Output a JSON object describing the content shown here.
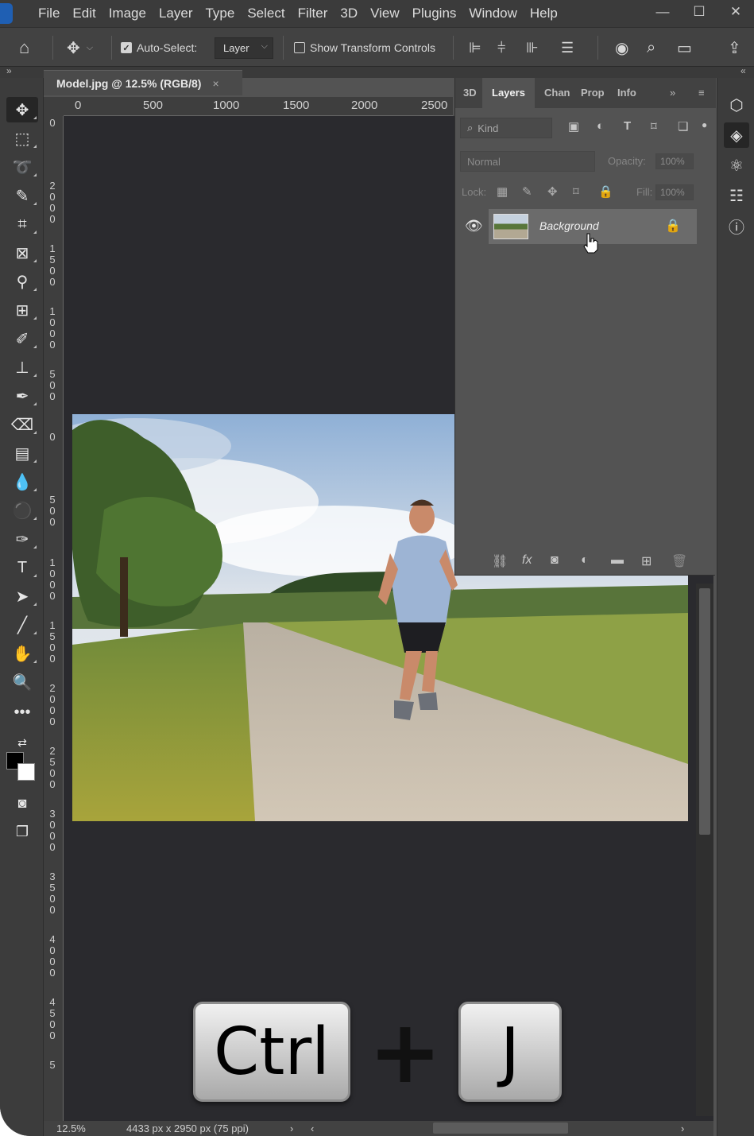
{
  "menu": {
    "items": [
      "File",
      "Edit",
      "Image",
      "Layer",
      "Type",
      "Select",
      "Filter",
      "3D",
      "View",
      "Plugins",
      "Window",
      "Help"
    ],
    "window_controls": [
      "—",
      "☐",
      "✕"
    ]
  },
  "options_bar": {
    "auto_select_label": "Auto-Select:",
    "auto_select_checked": true,
    "auto_select_target": "Layer",
    "show_transform_label": "Show Transform Controls",
    "show_transform_checked": false
  },
  "document": {
    "tab_title": "Model.jpg @ 12.5% (RGB/8)",
    "tab_close": "×",
    "ruler_h": [
      "0",
      "500",
      "1000",
      "1500",
      "2000",
      "2500"
    ],
    "ruler_v": [
      "0",
      "2000",
      "1500",
      "1000",
      "500",
      "0",
      "500",
      "1000",
      "1500",
      "2000",
      "2500",
      "3000",
      "3500",
      "4000",
      "4500",
      "5"
    ],
    "status_zoom": "12.5%",
    "status_info": "4433 px x 2950 px (75 ppi)"
  },
  "layers_panel": {
    "tabs": [
      "3D",
      "Layers",
      "Chan",
      "Prop",
      "Info"
    ],
    "active_tab": "Layers",
    "filter_placeholder": "Kind",
    "blend_mode": "Normal",
    "opacity_label": "Opacity:",
    "opacity_value": "100%",
    "lock_label": "Lock:",
    "fill_label": "Fill:",
    "fill_value": "100%",
    "layers": [
      {
        "name": "Background",
        "visible": true,
        "locked": true
      }
    ]
  },
  "overlay": {
    "key1": "Ctrl",
    "plus": "+",
    "key2": "J"
  },
  "colors": {
    "accent": "#1f5fb3",
    "panel": "#535353",
    "canvas": "#2a2a2e"
  }
}
